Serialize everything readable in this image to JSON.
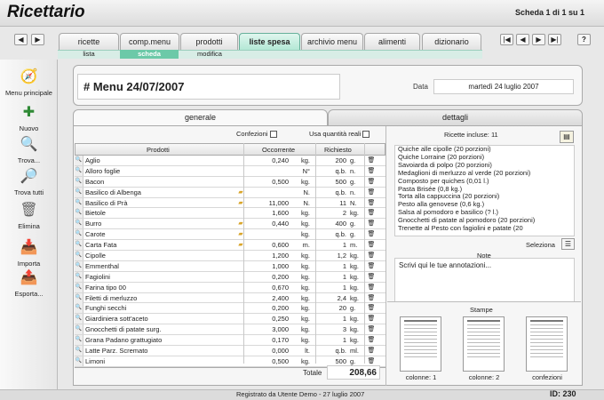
{
  "app": {
    "title": "Ricettario",
    "record_info": "Scheda 1 di 1 su 1"
  },
  "nav": {
    "back": "◀",
    "forward": "▶",
    "first": "|◀",
    "prev": "◀",
    "next": "▶",
    "last": "▶|",
    "help": "?"
  },
  "tabs": [
    "ricette",
    "comp.menu",
    "prodotti",
    "liste spesa",
    "archivio menu",
    "alimenti",
    "dizionario"
  ],
  "active_tab": "liste spesa",
  "subtabs": [
    "lista",
    "scheda",
    "modifica"
  ],
  "active_subtab": "scheda",
  "sidebar": [
    {
      "label": "Menu principale",
      "icon": "compass-icon"
    },
    {
      "label": "Nuovo",
      "icon": "new-record-icon"
    },
    {
      "label": "Trova...",
      "icon": "search-icon"
    },
    {
      "label": "Trova tutti",
      "icon": "search-all-icon"
    },
    {
      "label": "Elimina",
      "icon": "trash-icon"
    },
    {
      "label": "Importa",
      "icon": "import-icon"
    },
    {
      "label": "Esporta...",
      "icon": "export-icon"
    }
  ],
  "menu": {
    "title": "# Menu 24/07/2007",
    "date_label": "Data",
    "date_value": "martedì 24 luglio 2007"
  },
  "content_tabs": {
    "generale": "generale",
    "dettagli": "dettagli"
  },
  "options": {
    "confezioni": "Confezioni",
    "quantita_reali": "Usa quantità reali"
  },
  "table": {
    "headers": {
      "prodotti": "Prodotti",
      "occorrente": "Occorrente",
      "richiesto": "Richiesto"
    },
    "rows": [
      {
        "name": "Aglio",
        "flag": false,
        "qty": "0,240",
        "unit": "kg.",
        "req": "200",
        "runit": "g."
      },
      {
        "name": "Alloro foglie",
        "flag": false,
        "qty": "",
        "unit": "N°",
        "req": "q.b.",
        "runit": "n."
      },
      {
        "name": "Bacon",
        "flag": false,
        "qty": "0,500",
        "unit": "kg.",
        "req": "500",
        "runit": "g."
      },
      {
        "name": "Basilico di Albenga",
        "flag": true,
        "qty": "",
        "unit": "N.",
        "req": "q.b.",
        "runit": "n."
      },
      {
        "name": "Basilico di Prà",
        "flag": true,
        "qty": "11,000",
        "unit": "N.",
        "req": "11",
        "runit": "N."
      },
      {
        "name": "Bietole",
        "flag": false,
        "qty": "1,600",
        "unit": "kg.",
        "req": "2",
        "runit": "kg."
      },
      {
        "name": "Burro",
        "flag": true,
        "qty": "0,440",
        "unit": "kg.",
        "req": "400",
        "runit": "g."
      },
      {
        "name": "Carote",
        "flag": true,
        "qty": "",
        "unit": "kg.",
        "req": "q.b.",
        "runit": "g."
      },
      {
        "name": "Carta Fata",
        "flag": true,
        "qty": "0,600",
        "unit": "m.",
        "req": "1",
        "runit": "m."
      },
      {
        "name": "Cipolle",
        "flag": false,
        "qty": "1,200",
        "unit": "kg.",
        "req": "1,2",
        "runit": "kg."
      },
      {
        "name": "Emmenthal",
        "flag": false,
        "qty": "1,000",
        "unit": "kg.",
        "req": "1",
        "runit": "kg."
      },
      {
        "name": "Fagiolini",
        "flag": false,
        "qty": "0,200",
        "unit": "kg.",
        "req": "1",
        "runit": "kg."
      },
      {
        "name": "Farina tipo 00",
        "flag": false,
        "qty": "0,670",
        "unit": "kg.",
        "req": "1",
        "runit": "kg."
      },
      {
        "name": "Filetti di merluzzo",
        "flag": false,
        "qty": "2,400",
        "unit": "kg.",
        "req": "2,4",
        "runit": "kg."
      },
      {
        "name": "Funghi secchi",
        "flag": false,
        "qty": "0,200",
        "unit": "kg.",
        "req": "20",
        "runit": "g."
      },
      {
        "name": "Giardiniera sott'aceto",
        "flag": false,
        "qty": "0,250",
        "unit": "kg.",
        "req": "1",
        "runit": "kg."
      },
      {
        "name": "Gnocchetti di patate surg.",
        "flag": false,
        "qty": "3,000",
        "unit": "kg.",
        "req": "3",
        "runit": "kg."
      },
      {
        "name": "Grana Padano grattugiato",
        "flag": false,
        "qty": "0,170",
        "unit": "kg.",
        "req": "1",
        "runit": "kg."
      },
      {
        "name": "Latte Parz. Scremato",
        "flag": false,
        "qty": "0,000",
        "unit": "lt.",
        "req": "q.b.",
        "runit": "ml."
      },
      {
        "name": "Limoni",
        "flag": false,
        "qty": "0,500",
        "unit": "kg.",
        "req": "500",
        "runit": "g."
      }
    ],
    "total_label": "Totale",
    "total_value": "208,66"
  },
  "recipes": {
    "label": "Ricette incluse: 11",
    "items": [
      "Quiche alle cipolle (20 porzioni)",
      "Quiche Lorraine (20 porzioni)",
      "Savoiarda di polpo (20 porzioni)",
      "Medaglioni di merluzzo al verde (20 porzioni)",
      "Composto per quiches (0,01 l.)",
      "Pasta Brisée (0,8 kg.)",
      "Torta alla cappuccina (20 porzioni)",
      "Pesto alla genovese (0,6 kg.)",
      "Salsa al pomodoro e basilico (? l.)",
      "Gnocchetti di patate al pomodoro (20 porzioni)",
      "Trenette al Pesto con fagiolini e patate (20"
    ],
    "select_label": "Seleziona"
  },
  "notes": {
    "label": "Note",
    "text": "Scrivi qui le tue annotazioni..."
  },
  "prints": {
    "label": "Stampe",
    "items": [
      "colonne: 1",
      "colonne: 2",
      "confezioni"
    ]
  },
  "footer": {
    "registered": "Registrato da Utente Demo - 27 luglio 2007",
    "id": "ID: 230"
  },
  "colors": {
    "active_tab": "#b4e8d6",
    "active_subtab": "#6cc9a8",
    "flag": "#d9a52a"
  }
}
